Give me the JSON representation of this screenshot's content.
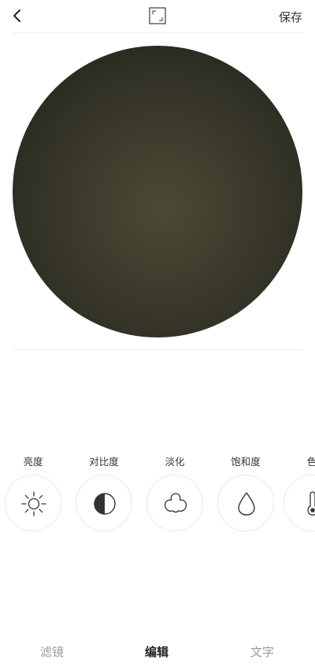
{
  "header": {
    "back_icon": "chevron-left-icon",
    "crop_icon": "crop-frame-icon",
    "save_label": "保存"
  },
  "preview": {
    "icon": "photo-preview"
  },
  "tools": [
    {
      "label": "亮度",
      "icon": "sun-icon"
    },
    {
      "label": "对比度",
      "icon": "half-circle-icon"
    },
    {
      "label": "淡化",
      "icon": "trefoil-icon"
    },
    {
      "label": "饱和度",
      "icon": "drop-icon"
    },
    {
      "label": "色",
      "icon": "thermometer-icon"
    }
  ],
  "tabs": [
    {
      "label": "滤镜",
      "active": false
    },
    {
      "label": "编辑",
      "active": true
    },
    {
      "label": "文字",
      "active": false
    }
  ],
  "colors": {
    "text": "#222222",
    "muted": "#9a9a9a",
    "divider": "#ececec",
    "preview": "#34331f"
  }
}
